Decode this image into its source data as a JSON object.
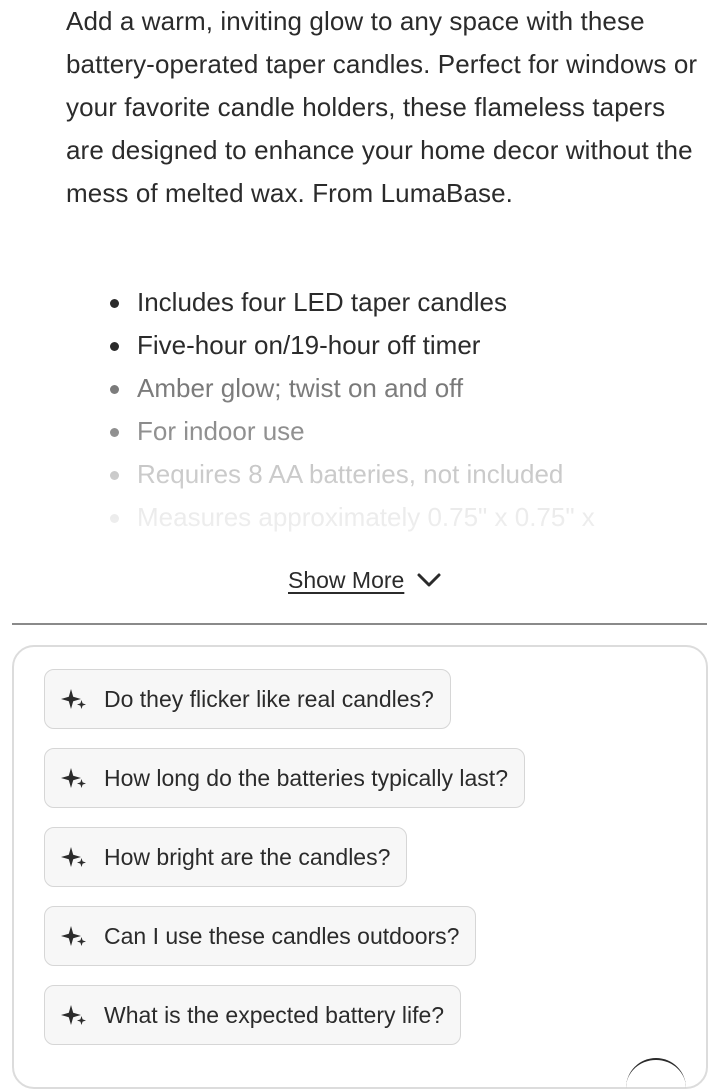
{
  "description": "Add a warm, inviting glow to any space with these battery-operated taper candles. Perfect for windows or your favorite candle holders, these flameless tapers are designed to enhance your home decor without the mess of melted wax. From LumaBase.",
  "features": [
    "Includes four LED taper candles",
    "Five-hour on/19-hour off timer",
    "Amber glow; twist on and off",
    "For indoor use",
    "Requires 8 AA batteries, not included",
    "Measures approximately 0.75\" x 0.75\" x"
  ],
  "show_more": {
    "label": "Show More",
    "icon": "chevron-down-icon"
  },
  "questions": [
    "Do they flicker like real candles?",
    "How long do the batteries typically last?",
    "How bright are the candles?",
    "Can I use these candles outdoors?",
    "What is the expected battery life?"
  ],
  "icons": {
    "question": "sparkle-icon"
  }
}
